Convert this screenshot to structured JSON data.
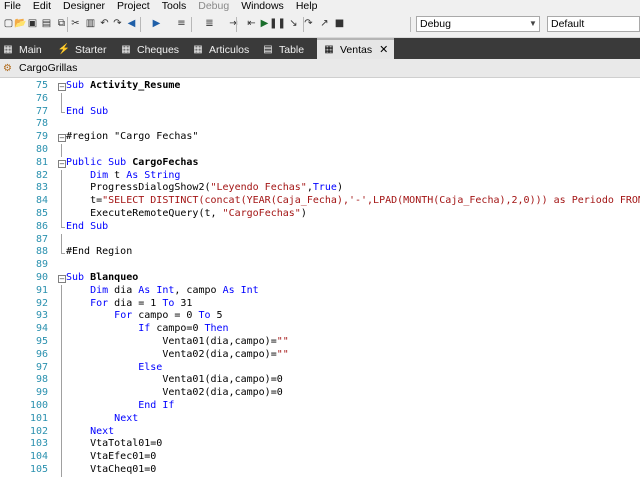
{
  "menubar": {
    "items": [
      {
        "label": "File",
        "disabled": false
      },
      {
        "label": "Edit",
        "disabled": false
      },
      {
        "label": "Designer",
        "disabled": false
      },
      {
        "label": "Project",
        "disabled": false
      },
      {
        "label": "Tools",
        "disabled": false
      },
      {
        "label": "Debug",
        "disabled": true
      },
      {
        "label": "Windows",
        "disabled": false
      },
      {
        "label": "Help",
        "disabled": false
      }
    ]
  },
  "toolbar": {
    "build_config": "Debug",
    "platform": "Default",
    "icons": [
      "new-file-icon",
      "open-file-icon",
      "save-icon",
      "save-all-icon",
      "copy-icon",
      "cut-icon",
      "paste-icon",
      "undo-icon",
      "redo-icon",
      "back-icon",
      "forward-icon",
      "comment-icon",
      "uncomment-icon",
      "indent-icon",
      "outdent-icon",
      "run-icon",
      "pause-icon",
      "step-in-icon",
      "step-over-icon",
      "step-out-icon",
      "stop-icon"
    ]
  },
  "tabs": [
    {
      "label": "Main",
      "icon": "module-icon",
      "active": false
    },
    {
      "label": "Starter",
      "icon": "starter-icon",
      "active": false
    },
    {
      "label": "Cheques",
      "icon": "module-icon",
      "active": false
    },
    {
      "label": "Articulos",
      "icon": "module-icon",
      "active": false
    },
    {
      "label": "Table",
      "icon": "table-icon",
      "active": false
    },
    {
      "label": "Ventas",
      "icon": "module-icon",
      "active": true
    }
  ],
  "subbar": {
    "label": "CargoGrillas"
  },
  "code_lines": [
    {
      "n": "75",
      "html": "<span class=\"kw\">Sub</span> <span class=\"bold\">Activity_Resume</span>",
      "fold": "minus"
    },
    {
      "n": "76",
      "html": "",
      "fold": "line"
    },
    {
      "n": "77",
      "html": "<span class=\"kw\">End Sub</span>",
      "fold": "end"
    },
    {
      "n": "78",
      "html": "",
      "fold": ""
    },
    {
      "n": "79",
      "html": "#region \"Cargo Fechas\"",
      "fold": "minus"
    },
    {
      "n": "80",
      "html": "",
      "fold": "line"
    },
    {
      "n": "81",
      "html": "<span class=\"kw\">Public Sub</span> <span class=\"bold\">CargoFechas</span>",
      "fold": "minus"
    },
    {
      "n": "82",
      "html": "    <span class=\"kw\">Dim</span> t <span class=\"kw\">As String</span>",
      "fold": "line"
    },
    {
      "n": "83",
      "html": "    ProgressDialogShow2(<span class=\"str\">\"Leyendo Fechas\"</span>,<span class=\"kw\">True</span>)",
      "fold": "line"
    },
    {
      "n": "84",
      "html": "    t=<span class=\"str\">\"SELECT DISTINCT(concat(YEAR(Caja_Fecha),'-',LPAD(MONTH(Caja_Fecha),2,0))) as Periodo FROM em_</span>",
      "fold": "line"
    },
    {
      "n": "85",
      "html": "    ExecuteRemoteQuery(t, <span class=\"str\">\"CargoFechas\"</span>)",
      "fold": "line"
    },
    {
      "n": "86",
      "html": "<span class=\"kw\">End Sub</span>",
      "fold": "end"
    },
    {
      "n": "87",
      "html": "",
      "fold": "line"
    },
    {
      "n": "88",
      "html": "#End Region",
      "fold": "end"
    },
    {
      "n": "89",
      "html": "",
      "fold": ""
    },
    {
      "n": "90",
      "html": "<span class=\"kw\">Sub</span> <span class=\"bold\">Blanqueo</span>",
      "fold": "minus"
    },
    {
      "n": "91",
      "html": "    <span class=\"kw\">Dim</span> dia <span class=\"kw\">As Int</span>, campo <span class=\"kw\">As Int</span>",
      "fold": "line"
    },
    {
      "n": "92",
      "html": "    <span class=\"kw\">For</span> dia = 1 <span class=\"kw\">To</span> 31",
      "fold": "line"
    },
    {
      "n": "93",
      "html": "        <span class=\"kw\">For</span> campo = 0 <span class=\"kw\">To</span> 5",
      "fold": "line"
    },
    {
      "n": "94",
      "html": "            <span class=\"kw\">If</span> campo=0 <span class=\"kw\">Then</span>",
      "fold": "line"
    },
    {
      "n": "95",
      "html": "                Venta01(dia,campo)=<span class=\"str\">\"\"</span>",
      "fold": "line"
    },
    {
      "n": "96",
      "html": "                Venta02(dia,campo)=<span class=\"str\">\"\"</span>",
      "fold": "line"
    },
    {
      "n": "97",
      "html": "            <span class=\"kw\">Else</span>",
      "fold": "line"
    },
    {
      "n": "98",
      "html": "                Venta01(dia,campo)=0",
      "fold": "line"
    },
    {
      "n": "99",
      "html": "                Venta02(dia,campo)=0",
      "fold": "line"
    },
    {
      "n": "100",
      "html": "            <span class=\"kw\">End If</span>",
      "fold": "line"
    },
    {
      "n": "101",
      "html": "        <span class=\"kw\">Next</span>",
      "fold": "line"
    },
    {
      "n": "102",
      "html": "    <span class=\"kw\">Next</span>",
      "fold": "line"
    },
    {
      "n": "103",
      "html": "    VtaTotal01=0",
      "fold": "line"
    },
    {
      "n": "104",
      "html": "    VtaEfec01=0",
      "fold": "line"
    },
    {
      "n": "105",
      "html": "    VtaCheq01=0",
      "fold": "line"
    }
  ]
}
